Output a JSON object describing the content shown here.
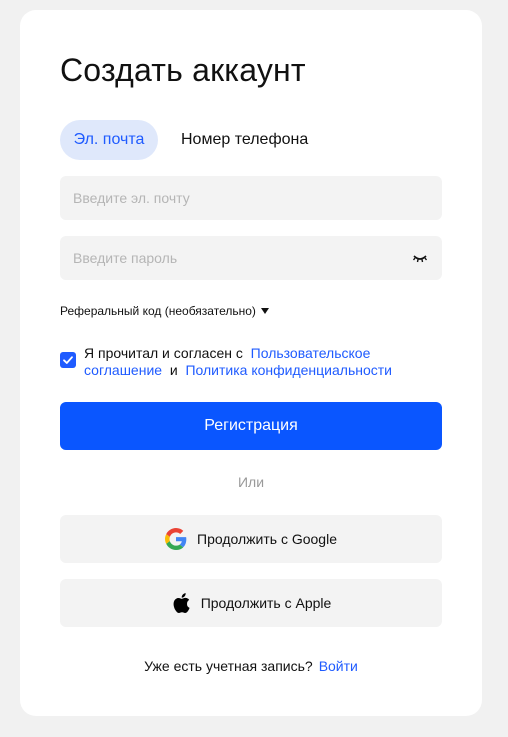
{
  "title": "Создать аккаунт",
  "tabs": [
    {
      "label": "Эл. почта",
      "active": true
    },
    {
      "label": "Номер телефона",
      "active": false
    }
  ],
  "email": {
    "placeholder": "Введите эл. почту",
    "value": ""
  },
  "password": {
    "placeholder": "Введите пароль",
    "value": ""
  },
  "referral": {
    "label": "Реферальный код (необязательно)"
  },
  "consent": {
    "checked": true,
    "prefix": "Я прочитал и согласен с",
    "link1": "Пользовательское соглашение",
    "joiner": "и",
    "link2": "Политика конфиденциальности"
  },
  "register_label": "Регистрация",
  "or_label": "Или",
  "google_label": "Продолжить с Google",
  "apple_label": "Продолжить с Apple",
  "footer": {
    "text": "Уже есть учетная запись?",
    "link": "Войти"
  },
  "colors": {
    "accent": "#0a56ff",
    "link": "#1f5bff",
    "tab_active_bg": "#dfe8fb",
    "field_bg": "#f3f3f3"
  }
}
